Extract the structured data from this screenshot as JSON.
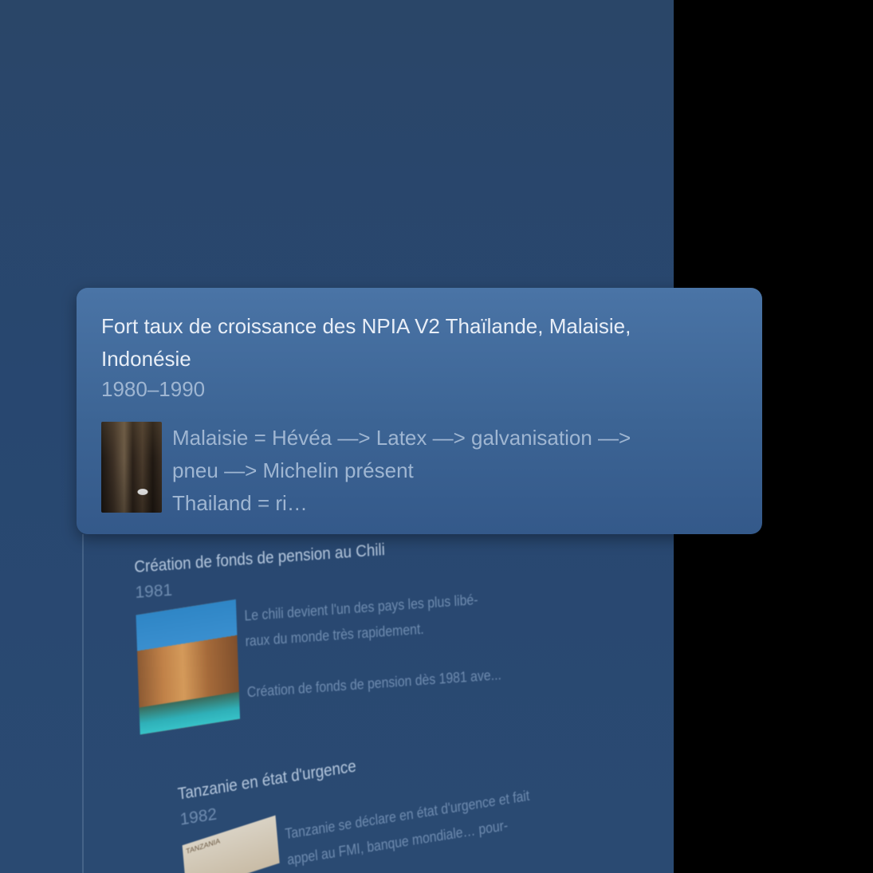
{
  "focused_event": {
    "title": "Fort taux de croissance des NPIA V2 Thaïlande, Malaisie, Indonésie",
    "date": "1980–1990",
    "image_icon": "rubber-tree-tapping-photo",
    "description_lines": [
      "Malaisie = Hévéa —> Latex —> galvanisation —>",
      "pneu —> Michelin présent",
      "Thailand = ri…"
    ]
  },
  "background_events": [
    {
      "title": "Création de fonds de pension au Chili",
      "date": "1981",
      "image_icon": "patagonia-mountains-photo",
      "description_lines": [
        "Le chili devient l'un des pays les plus libé-",
        "raux du monde très rapidement.",
        "",
        "Création de fonds de pension dès 1981 ave..."
      ]
    },
    {
      "title": "Tanzanie en état d'urgence",
      "date": "1982",
      "image_icon": "tanzania-map-photo",
      "image_label": "TANZANIA",
      "description_lines": [
        "Tanzanie se déclare en état d'urgence et fait",
        "appel au FMI, banque mondiale… pour-"
      ]
    }
  ]
}
